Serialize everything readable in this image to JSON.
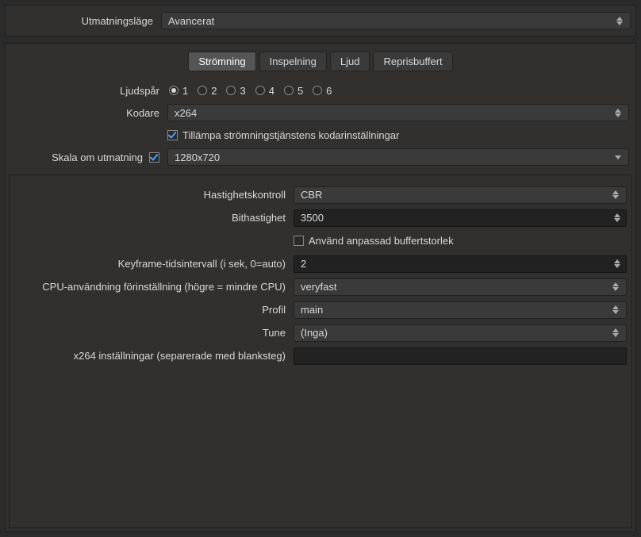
{
  "top": {
    "output_mode_label": "Utmatningsläge",
    "output_mode_value": "Avancerat"
  },
  "tabs": {
    "streaming": "Strömning",
    "recording": "Inspelning",
    "audio": "Ljud",
    "replay_buffer": "Reprisbuffert"
  },
  "streaming": {
    "audio_track_label": "Ljudspår",
    "tracks": [
      "1",
      "2",
      "3",
      "4",
      "5",
      "6"
    ],
    "selected_track_index": 0,
    "encoder_label": "Kodare",
    "encoder_value": "x264",
    "enforce_label": "Tillämpa strömningstjänstens kodarinställningar",
    "rescale_label": "Skala om utmatning",
    "rescale_value": "1280x720"
  },
  "encoder": {
    "rate_control_label": "Hastighetskontroll",
    "rate_control_value": "CBR",
    "bitrate_label": "Bithastighet",
    "bitrate_value": "3500",
    "custom_buf_label": "Använd anpassad buffertstorlek",
    "keyframe_label": "Keyframe-tidsintervall (i sek, 0=auto)",
    "keyframe_value": "2",
    "cpu_label": "CPU-användning förinställning (högre = mindre CPU)",
    "cpu_value": "veryfast",
    "profile_label": "Profil",
    "profile_value": "main",
    "tune_label": "Tune",
    "tune_value": "(Inga)",
    "x264opts_label": "x264 inställningar (separerade med blanksteg)",
    "x264opts_value": ""
  }
}
